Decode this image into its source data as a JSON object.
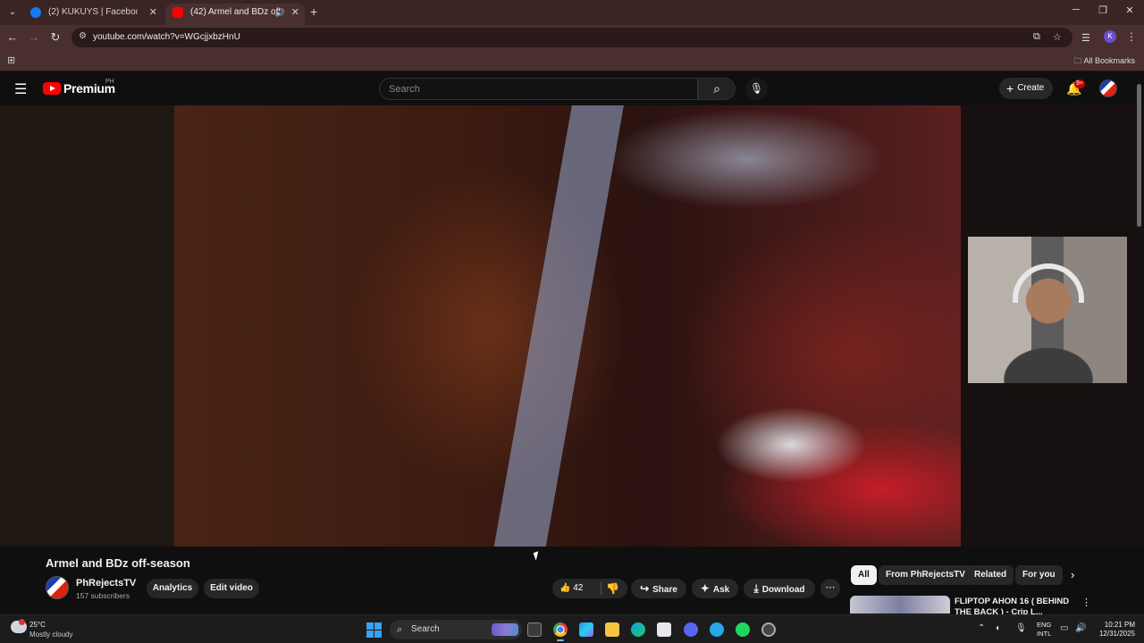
{
  "browser": {
    "tabs": [
      {
        "label": "(2) KUKUYS | Facebook",
        "favicon": "facebook-icon",
        "color": "#1877f2",
        "active": false
      },
      {
        "label": "(42) Armel and BDz off-season",
        "favicon": "youtube-icon",
        "color": "#ff0000",
        "active": true
      }
    ],
    "url": "youtube.com/watch?v=WGcjjxbzHnU",
    "profile_initial": "K",
    "all_bookmarks": "All Bookmarks"
  },
  "youtube": {
    "logo_text": "Premium",
    "country_code": "PH",
    "search_placeholder": "Search",
    "create_label": "Create",
    "notification_badge": "9+"
  },
  "video": {
    "title": "Armel and BDz off-season",
    "channel": "PhRejectsTV",
    "subscribers": "157 subscribers",
    "analytics_label": "Analytics",
    "edit_label": "Edit video",
    "likes": "42",
    "share_label": "Share",
    "ask_label": "Ask",
    "download_label": "Download"
  },
  "sidebar": {
    "chips": [
      "All",
      "From PhRejectsTV",
      "Related",
      "For you"
    ],
    "recommended": {
      "title": "FLIPTOP AHON 16 ( BEHIND THE BACK ) - Crip L..."
    }
  },
  "taskbar": {
    "temperature": "25°C",
    "condition": "Mostly cloudy",
    "search_label": "Search",
    "lang_line1": "ENG",
    "lang_line2": "INTL",
    "time": "10:21 PM",
    "date": "12/31/2025"
  }
}
